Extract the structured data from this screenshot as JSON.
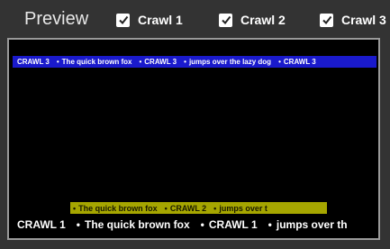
{
  "header": {
    "title": "Preview",
    "toggles": [
      {
        "label": "Crawl 1",
        "checked": true
      },
      {
        "label": "Crawl 2",
        "checked": true
      },
      {
        "label": "Crawl 3",
        "checked": true
      }
    ]
  },
  "crawls": {
    "crawl3": {
      "segments": [
        "CRAWL 3",
        "The quick brown fox",
        "CRAWL 3",
        "jumps over the lazy dog",
        "CRAWL 3"
      ],
      "separator": "•",
      "background": "#1a1acc",
      "text_color": "#ffffff"
    },
    "crawl2": {
      "segments": [
        "The quick brown fox",
        "CRAWL 2",
        "jumps over t"
      ],
      "separator": "•",
      "background": "#a6a600",
      "text_color": "#1a1a00"
    },
    "crawl1": {
      "segments": [
        "CRAWL 1",
        "The quick brown fox",
        "CRAWL 1",
        "jumps over th"
      ],
      "separator": "•",
      "background": "#000000",
      "text_color": "#ffffff"
    }
  },
  "icons": {
    "checkbox": "checkmark-icon"
  },
  "colors": {
    "panel_background": "#333333",
    "preview_background": "#000000",
    "frame_border": "#9a9a9a"
  }
}
